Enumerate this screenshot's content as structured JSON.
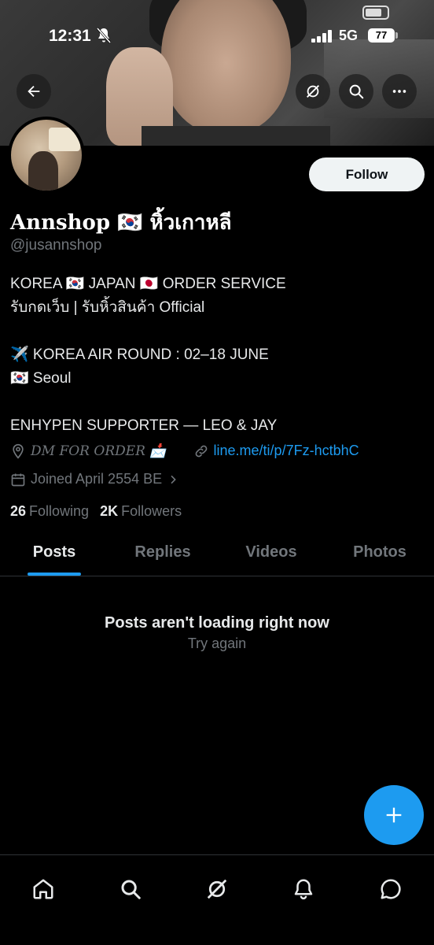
{
  "status_bar": {
    "time": "12:31",
    "network": "5G",
    "battery": "77"
  },
  "profile": {
    "name": "Annshop 🇰🇷 หิ้วเกาหลี",
    "handle": "@jusannshop",
    "bio": "KOREA 🇰🇷 JAPAN 🇯🇵 ORDER SERVICE\nรับกดเว็บ | รับหิ้วสินค้า Official\n\n✈️ KOREA AIR ROUND : 02–18 JUNE\n🇰🇷 Seoul\n\nENHYPEN SUPPORTER — LEO & JAY",
    "location": "DM FOR ORDER 📩",
    "link": "line.me/ti/p/7Fz-hctbhC",
    "joined": "Joined April 2554 BE",
    "following_count": "26",
    "following_label": "Following",
    "followers_count": "2K",
    "followers_label": "Followers",
    "follow_button": "Follow"
  },
  "tabs": [
    {
      "label": "Posts",
      "active": true
    },
    {
      "label": "Replies",
      "active": false
    },
    {
      "label": "Videos",
      "active": false
    },
    {
      "label": "Photos",
      "active": false
    }
  ],
  "feed": {
    "empty_title": "Posts aren't loading right now",
    "retry": "Try again"
  },
  "icons": {
    "back": "back-arrow-icon",
    "grok": "grok-icon",
    "search": "search-icon",
    "more": "more-icon",
    "compose": "plus-icon",
    "nav": [
      "home-icon",
      "search-icon",
      "grok-icon",
      "bell-icon",
      "message-icon"
    ]
  },
  "colors": {
    "accent": "#1d9bf0",
    "background": "#000000",
    "muted": "#71767b"
  }
}
